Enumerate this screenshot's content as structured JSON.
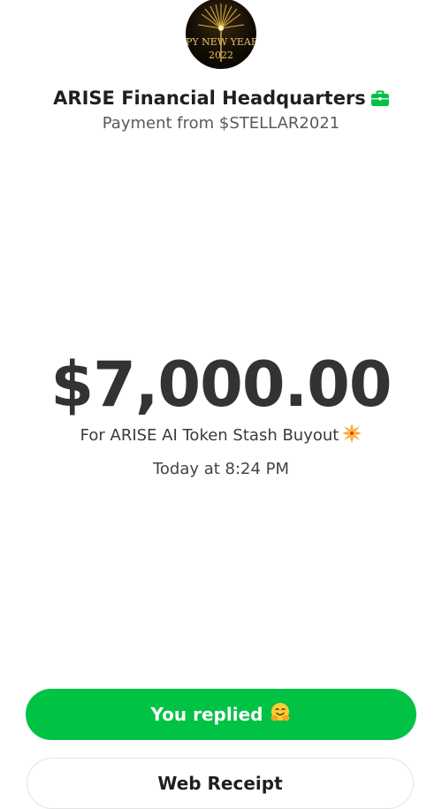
{
  "header": {
    "avatar": {
      "line1": "PY NEW YEAR",
      "line2": "2022",
      "icon": "fireworks-avatar"
    },
    "merchant_name": "ARISE Financial Headquarters",
    "merchant_icon": "briefcase-icon",
    "subtitle": "Payment from $STELLAR2021"
  },
  "payment": {
    "amount": "$7,000.00",
    "note": "For ARISE AI Token Stash Buyout",
    "note_icon": "collision-icon",
    "time": "Today at 8:24 PM"
  },
  "actions": {
    "replied_label": "You replied",
    "replied_icon": "hugging-face-icon",
    "receipt_label": "Web Receipt"
  },
  "colors": {
    "brand_green": "#00c244",
    "briefcase_green": "#00c244"
  }
}
